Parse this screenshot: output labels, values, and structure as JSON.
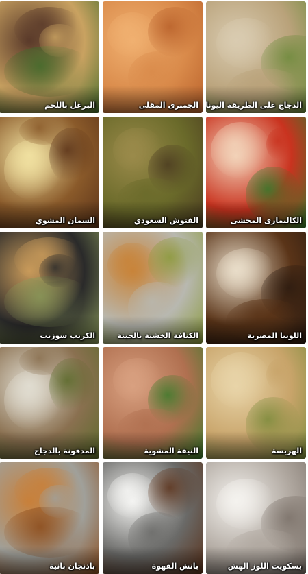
{
  "recipes": [
    {
      "title": "الدجاج على الطريقة اليونانية",
      "bg": "#b9a27a",
      "accent": "#d9cbb0",
      "detail": "#6b8a3a"
    },
    {
      "title": "الجمبرى المقلى",
      "bg": "#d98a4a",
      "accent": "#f0b070",
      "detail": "#b8602a"
    },
    {
      "title": "البرغل باللحم",
      "bg": "#c9a261",
      "accent": "#5a3a2a",
      "detail": "#3f6b2a"
    },
    {
      "title": "الكاليمارى المحشى",
      "bg": "#c9331f",
      "accent": "#f2d2b8",
      "detail": "#2f7a2a"
    },
    {
      "title": "الفتوش السعودي",
      "bg": "#6a6a2a",
      "accent": "#9a8a4a",
      "detail": "#4a3a20"
    },
    {
      "title": "السمان المشوي",
      "bg": "#8a5a2a",
      "accent": "#f0e0a0",
      "detail": "#5a3218"
    },
    {
      "title": "اللوبيا المصرية",
      "bg": "#5a3418",
      "accent": "#e8dcc8",
      "detail": "#2a1a10"
    },
    {
      "title": "الكنافة الخشنة بالجبنة",
      "bg": "#b8b8b0",
      "accent": "#c8843a",
      "detail": "#8a9a3a"
    },
    {
      "title": "الكريب سوزيت",
      "bg": "#2a2a2a",
      "accent": "#c89a5a",
      "detail": "#8a9a5a"
    },
    {
      "title": "الهريسة",
      "bg": "#c8a46a",
      "accent": "#e8d4a8",
      "detail": "#7a8a3a"
    },
    {
      "title": "النيفة المشوية",
      "bg": "#b07050",
      "accent": "#d8a080",
      "detail": "#3a7a2a"
    },
    {
      "title": "المدفونة بالدجاج",
      "bg": "#8a7050",
      "accent": "#e0dcd0",
      "detail": "#5a6a2a"
    },
    {
      "title": "بسكويت اللوز الهش",
      "bg": "#b0a8a0",
      "accent": "#f4f2ee",
      "detail": "#7a7068"
    },
    {
      "title": "بانش القهوة",
      "bg": "#6a6a68",
      "accent": "#f4f4f2",
      "detail": "#5a3018"
    },
    {
      "title": "باذنجان بانية",
      "bg": "#a0a09a",
      "accent": "#c8803a",
      "detail": "#8a4a1a"
    }
  ]
}
